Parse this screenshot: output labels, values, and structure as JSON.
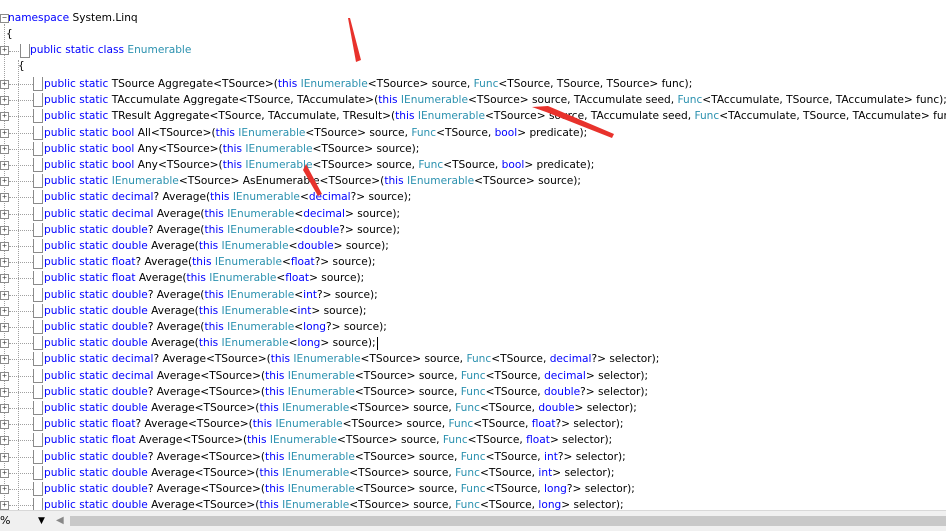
{
  "editor": {
    "namespace_line": [
      {
        "t": "namespace",
        "c": "kw"
      },
      {
        "t": " System.Linq",
        "c": "bp"
      }
    ],
    "open_brace_outer": "{",
    "class_line": [
      {
        "t": "public",
        "c": "kw"
      },
      {
        "t": " static ",
        "c": "kw"
      },
      {
        "t": "class",
        "c": "kw"
      },
      {
        "t": " Enumerable",
        "c": "ty"
      }
    ],
    "open_brace_inner": "{",
    "methods": [
      [
        {
          "t": "public static ",
          "c": "kw"
        },
        {
          "t": "TSource Aggregate<TSource>(",
          "c": "bp"
        },
        {
          "t": "this ",
          "c": "kw"
        },
        {
          "t": "IEnumerable",
          "c": "ty"
        },
        {
          "t": "<TSource> source, ",
          "c": "bp"
        },
        {
          "t": "Func",
          "c": "ty"
        },
        {
          "t": "<TSource, TSource, TSource> func);",
          "c": "bp"
        }
      ],
      [
        {
          "t": "public static ",
          "c": "kw"
        },
        {
          "t": "TAccumulate Aggregate<TSource, TAccumulate>(",
          "c": "bp"
        },
        {
          "t": "this ",
          "c": "kw"
        },
        {
          "t": "IEnumerable",
          "c": "ty"
        },
        {
          "t": "<TSource> source, TAccumulate seed, ",
          "c": "bp"
        },
        {
          "t": "Func",
          "c": "ty"
        },
        {
          "t": "<TAccumulate, TSource, TAccumulate> func);",
          "c": "bp"
        }
      ],
      [
        {
          "t": "public static ",
          "c": "kw"
        },
        {
          "t": "TResult Aggregate<TSource, TAccumulate, TResult>(",
          "c": "bp"
        },
        {
          "t": "this ",
          "c": "kw"
        },
        {
          "t": "IEnumerable",
          "c": "ty"
        },
        {
          "t": "<TSource> source, TAccumulate seed, ",
          "c": "bp"
        },
        {
          "t": "Func",
          "c": "ty"
        },
        {
          "t": "<TAccumulate, TSource, TAccumulate> func",
          "c": "bp"
        }
      ],
      [
        {
          "t": "public static ",
          "c": "kw"
        },
        {
          "t": "bool",
          "c": "kw"
        },
        {
          "t": " All<TSource>(",
          "c": "bp"
        },
        {
          "t": "this ",
          "c": "kw"
        },
        {
          "t": "IEnumerable",
          "c": "ty"
        },
        {
          "t": "<TSource> source, ",
          "c": "bp"
        },
        {
          "t": "Func",
          "c": "ty"
        },
        {
          "t": "<TSource, ",
          "c": "bp"
        },
        {
          "t": "bool",
          "c": "kw"
        },
        {
          "t": "> predicate);",
          "c": "bp"
        }
      ],
      [
        {
          "t": "public static ",
          "c": "kw"
        },
        {
          "t": "bool",
          "c": "kw"
        },
        {
          "t": " Any<TSource>(",
          "c": "bp"
        },
        {
          "t": "this ",
          "c": "kw"
        },
        {
          "t": "IEnumerable",
          "c": "ty"
        },
        {
          "t": "<TSource> source);",
          "c": "bp"
        }
      ],
      [
        {
          "t": "public static ",
          "c": "kw"
        },
        {
          "t": "bool",
          "c": "kw"
        },
        {
          "t": " Any<TSource>(",
          "c": "bp"
        },
        {
          "t": "this ",
          "c": "kw"
        },
        {
          "t": "IEnumerable",
          "c": "ty"
        },
        {
          "t": "<TSource> source, ",
          "c": "bp"
        },
        {
          "t": "Func",
          "c": "ty"
        },
        {
          "t": "<TSource, ",
          "c": "bp"
        },
        {
          "t": "bool",
          "c": "kw"
        },
        {
          "t": "> predicate);",
          "c": "bp"
        }
      ],
      [
        {
          "t": "public static ",
          "c": "kw"
        },
        {
          "t": "IEnumerable",
          "c": "ty"
        },
        {
          "t": "<TSource> AsEnumerable<TSource>(",
          "c": "bp"
        },
        {
          "t": "this ",
          "c": "kw"
        },
        {
          "t": "IEnumerable",
          "c": "ty"
        },
        {
          "t": "<TSource> source);",
          "c": "bp"
        }
      ],
      [
        {
          "t": "public static ",
          "c": "kw"
        },
        {
          "t": "decimal",
          "c": "kw"
        },
        {
          "t": "? Average(",
          "c": "bp"
        },
        {
          "t": "this ",
          "c": "kw"
        },
        {
          "t": "IEnumerable",
          "c": "ty"
        },
        {
          "t": "<",
          "c": "bp"
        },
        {
          "t": "decimal",
          "c": "kw"
        },
        {
          "t": "?> source);",
          "c": "bp"
        }
      ],
      [
        {
          "t": "public static ",
          "c": "kw"
        },
        {
          "t": "decimal",
          "c": "kw"
        },
        {
          "t": " Average(",
          "c": "bp"
        },
        {
          "t": "this ",
          "c": "kw"
        },
        {
          "t": "IEnumerable",
          "c": "ty"
        },
        {
          "t": "<",
          "c": "bp"
        },
        {
          "t": "decimal",
          "c": "kw"
        },
        {
          "t": "> source);",
          "c": "bp"
        }
      ],
      [
        {
          "t": "public static ",
          "c": "kw"
        },
        {
          "t": "double",
          "c": "kw"
        },
        {
          "t": "? Average(",
          "c": "bp"
        },
        {
          "t": "this ",
          "c": "kw"
        },
        {
          "t": "IEnumerable",
          "c": "ty"
        },
        {
          "t": "<",
          "c": "bp"
        },
        {
          "t": "double",
          "c": "kw"
        },
        {
          "t": "?> source);",
          "c": "bp"
        }
      ],
      [
        {
          "t": "public static ",
          "c": "kw"
        },
        {
          "t": "double",
          "c": "kw"
        },
        {
          "t": " Average(",
          "c": "bp"
        },
        {
          "t": "this ",
          "c": "kw"
        },
        {
          "t": "IEnumerable",
          "c": "ty"
        },
        {
          "t": "<",
          "c": "bp"
        },
        {
          "t": "double",
          "c": "kw"
        },
        {
          "t": "> source);",
          "c": "bp"
        }
      ],
      [
        {
          "t": "public static ",
          "c": "kw"
        },
        {
          "t": "float",
          "c": "kw"
        },
        {
          "t": "? Average(",
          "c": "bp"
        },
        {
          "t": "this ",
          "c": "kw"
        },
        {
          "t": "IEnumerable",
          "c": "ty"
        },
        {
          "t": "<",
          "c": "bp"
        },
        {
          "t": "float",
          "c": "kw"
        },
        {
          "t": "?> source);",
          "c": "bp"
        }
      ],
      [
        {
          "t": "public static ",
          "c": "kw"
        },
        {
          "t": "float",
          "c": "kw"
        },
        {
          "t": " Average(",
          "c": "bp"
        },
        {
          "t": "this ",
          "c": "kw"
        },
        {
          "t": "IEnumerable",
          "c": "ty"
        },
        {
          "t": "<",
          "c": "bp"
        },
        {
          "t": "float",
          "c": "kw"
        },
        {
          "t": "> source);",
          "c": "bp"
        }
      ],
      [
        {
          "t": "public static ",
          "c": "kw"
        },
        {
          "t": "double",
          "c": "kw"
        },
        {
          "t": "? Average(",
          "c": "bp"
        },
        {
          "t": "this ",
          "c": "kw"
        },
        {
          "t": "IEnumerable",
          "c": "ty"
        },
        {
          "t": "<",
          "c": "bp"
        },
        {
          "t": "int",
          "c": "kw"
        },
        {
          "t": "?> source);",
          "c": "bp"
        }
      ],
      [
        {
          "t": "public static ",
          "c": "kw"
        },
        {
          "t": "double",
          "c": "kw"
        },
        {
          "t": " Average(",
          "c": "bp"
        },
        {
          "t": "this ",
          "c": "kw"
        },
        {
          "t": "IEnumerable",
          "c": "ty"
        },
        {
          "t": "<",
          "c": "bp"
        },
        {
          "t": "int",
          "c": "kw"
        },
        {
          "t": "> source);",
          "c": "bp"
        }
      ],
      [
        {
          "t": "public static ",
          "c": "kw"
        },
        {
          "t": "double",
          "c": "kw"
        },
        {
          "t": "? Average(",
          "c": "bp"
        },
        {
          "t": "this ",
          "c": "kw"
        },
        {
          "t": "IEnumerable",
          "c": "ty"
        },
        {
          "t": "<",
          "c": "bp"
        },
        {
          "t": "long",
          "c": "kw"
        },
        {
          "t": "?> source);",
          "c": "bp"
        }
      ],
      [
        {
          "t": "public static ",
          "c": "kw"
        },
        {
          "t": "double",
          "c": "kw"
        },
        {
          "t": " Average(",
          "c": "bp"
        },
        {
          "t": "this ",
          "c": "kw"
        },
        {
          "t": "IEnumerable",
          "c": "ty"
        },
        {
          "t": "<",
          "c": "bp"
        },
        {
          "t": "long",
          "c": "kw"
        },
        {
          "t": "> source);",
          "c": "bp"
        }
      ],
      [
        {
          "t": "public static ",
          "c": "kw"
        },
        {
          "t": "decimal",
          "c": "kw"
        },
        {
          "t": "? Average<TSource>(",
          "c": "bp"
        },
        {
          "t": "this ",
          "c": "kw"
        },
        {
          "t": "IEnumerable",
          "c": "ty"
        },
        {
          "t": "<TSource> source, ",
          "c": "bp"
        },
        {
          "t": "Func",
          "c": "ty"
        },
        {
          "t": "<TSource, ",
          "c": "bp"
        },
        {
          "t": "decimal",
          "c": "kw"
        },
        {
          "t": "?> selector);",
          "c": "bp"
        }
      ],
      [
        {
          "t": "public static ",
          "c": "kw"
        },
        {
          "t": "decimal",
          "c": "kw"
        },
        {
          "t": " Average<TSource>(",
          "c": "bp"
        },
        {
          "t": "this ",
          "c": "kw"
        },
        {
          "t": "IEnumerable",
          "c": "ty"
        },
        {
          "t": "<TSource> source, ",
          "c": "bp"
        },
        {
          "t": "Func",
          "c": "ty"
        },
        {
          "t": "<TSource, ",
          "c": "bp"
        },
        {
          "t": "decimal",
          "c": "kw"
        },
        {
          "t": "> selector);",
          "c": "bp"
        }
      ],
      [
        {
          "t": "public static ",
          "c": "kw"
        },
        {
          "t": "double",
          "c": "kw"
        },
        {
          "t": "? Average<TSource>(",
          "c": "bp"
        },
        {
          "t": "this ",
          "c": "kw"
        },
        {
          "t": "IEnumerable",
          "c": "ty"
        },
        {
          "t": "<TSource> source, ",
          "c": "bp"
        },
        {
          "t": "Func",
          "c": "ty"
        },
        {
          "t": "<TSource, ",
          "c": "bp"
        },
        {
          "t": "double",
          "c": "kw"
        },
        {
          "t": "?> selector);",
          "c": "bp"
        }
      ],
      [
        {
          "t": "public static ",
          "c": "kw"
        },
        {
          "t": "double",
          "c": "kw"
        },
        {
          "t": " Average<TSource>(",
          "c": "bp"
        },
        {
          "t": "this ",
          "c": "kw"
        },
        {
          "t": "IEnumerable",
          "c": "ty"
        },
        {
          "t": "<TSource> source, ",
          "c": "bp"
        },
        {
          "t": "Func",
          "c": "ty"
        },
        {
          "t": "<TSource, ",
          "c": "bp"
        },
        {
          "t": "double",
          "c": "kw"
        },
        {
          "t": "> selector);",
          "c": "bp"
        }
      ],
      [
        {
          "t": "public static ",
          "c": "kw"
        },
        {
          "t": "float",
          "c": "kw"
        },
        {
          "t": "? Average<TSource>(",
          "c": "bp"
        },
        {
          "t": "this ",
          "c": "kw"
        },
        {
          "t": "IEnumerable",
          "c": "ty"
        },
        {
          "t": "<TSource> source, ",
          "c": "bp"
        },
        {
          "t": "Func",
          "c": "ty"
        },
        {
          "t": "<TSource, ",
          "c": "bp"
        },
        {
          "t": "float",
          "c": "kw"
        },
        {
          "t": "?> selector);",
          "c": "bp"
        }
      ],
      [
        {
          "t": "public static ",
          "c": "kw"
        },
        {
          "t": "float",
          "c": "kw"
        },
        {
          "t": " Average<TSource>(",
          "c": "bp"
        },
        {
          "t": "this ",
          "c": "kw"
        },
        {
          "t": "IEnumerable",
          "c": "ty"
        },
        {
          "t": "<TSource> source, ",
          "c": "bp"
        },
        {
          "t": "Func",
          "c": "ty"
        },
        {
          "t": "<TSource, ",
          "c": "bp"
        },
        {
          "t": "float",
          "c": "kw"
        },
        {
          "t": "> selector);",
          "c": "bp"
        }
      ],
      [
        {
          "t": "public static ",
          "c": "kw"
        },
        {
          "t": "double",
          "c": "kw"
        },
        {
          "t": "? Average<TSource>(",
          "c": "bp"
        },
        {
          "t": "this ",
          "c": "kw"
        },
        {
          "t": "IEnumerable",
          "c": "ty"
        },
        {
          "t": "<TSource> source, ",
          "c": "bp"
        },
        {
          "t": "Func",
          "c": "ty"
        },
        {
          "t": "<TSource, ",
          "c": "bp"
        },
        {
          "t": "int",
          "c": "kw"
        },
        {
          "t": "?> selector);",
          "c": "bp"
        }
      ],
      [
        {
          "t": "public static ",
          "c": "kw"
        },
        {
          "t": "double",
          "c": "kw"
        },
        {
          "t": " Average<TSource>(",
          "c": "bp"
        },
        {
          "t": "this ",
          "c": "kw"
        },
        {
          "t": "IEnumerable",
          "c": "ty"
        },
        {
          "t": "<TSource> source, ",
          "c": "bp"
        },
        {
          "t": "Func",
          "c": "ty"
        },
        {
          "t": "<TSource, ",
          "c": "bp"
        },
        {
          "t": "int",
          "c": "kw"
        },
        {
          "t": "> selector);",
          "c": "bp"
        }
      ],
      [
        {
          "t": "public static ",
          "c": "kw"
        },
        {
          "t": "double",
          "c": "kw"
        },
        {
          "t": "? Average<TSource>(",
          "c": "bp"
        },
        {
          "t": "this ",
          "c": "kw"
        },
        {
          "t": "IEnumerable",
          "c": "ty"
        },
        {
          "t": "<TSource> source, ",
          "c": "bp"
        },
        {
          "t": "Func",
          "c": "ty"
        },
        {
          "t": "<TSource, ",
          "c": "bp"
        },
        {
          "t": "long",
          "c": "kw"
        },
        {
          "t": "?> selector);",
          "c": "bp"
        }
      ],
      [
        {
          "t": "public static ",
          "c": "kw"
        },
        {
          "t": "double",
          "c": "kw"
        },
        {
          "t": " Average<TSource>(",
          "c": "bp"
        },
        {
          "t": "this ",
          "c": "kw"
        },
        {
          "t": "IEnumerable",
          "c": "ty"
        },
        {
          "t": "<TSource> source, ",
          "c": "bp"
        },
        {
          "t": "Func",
          "c": "ty"
        },
        {
          "t": "<TSource, ",
          "c": "bp"
        },
        {
          "t": "long",
          "c": "kw"
        },
        {
          "t": "> selector);",
          "c": "bp"
        }
      ]
    ],
    "cursor_line_index": 16
  },
  "statusbar": {
    "zoom_value": "%",
    "zoom_dropdown_icon": "chevron-down-icon",
    "scroll_left_icon": "chevron-left-icon"
  },
  "colors": {
    "keyword": "#0000ff",
    "type": "#2b91af",
    "plain": "#000000",
    "annotation_arrow": "#e8322c"
  }
}
